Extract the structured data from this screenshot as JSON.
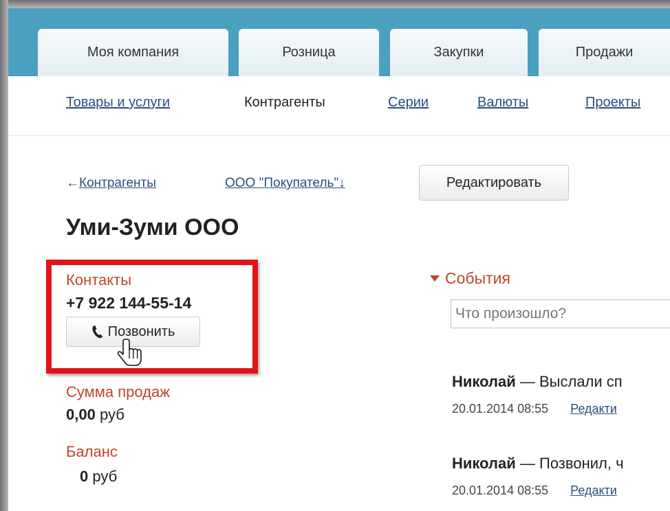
{
  "tabs": [
    {
      "label": "Моя компания"
    },
    {
      "label": "Розница"
    },
    {
      "label": "Закупки"
    },
    {
      "label": "Продажи"
    }
  ],
  "subnav": [
    {
      "label": "Товары и услуги"
    },
    {
      "label": "Контрагенты"
    },
    {
      "label": "Серии"
    },
    {
      "label": "Валюты"
    },
    {
      "label": "Проекты"
    }
  ],
  "breadcrumb": {
    "back_arrow": "←",
    "back_label": "Контрагенты",
    "org_label": "ООО \"Покупатель\"↓"
  },
  "edit_button": "Редактировать",
  "title": "Уми-Зуми ООО",
  "contacts": {
    "label": "Контакты",
    "phone": "+7 922 144-55-14",
    "call_button": "Позвонить"
  },
  "sales": {
    "label": "Сумма продаж",
    "amount": "0,00",
    "currency": "руб"
  },
  "balance": {
    "label": "Баланс",
    "amount": "0",
    "currency": "руб"
  },
  "events": {
    "header": "События",
    "search_placeholder": "Что произошло?",
    "items": [
      {
        "author": "Николай",
        "separator": " — ",
        "text": "Выслали сп",
        "date": "20.01.2014 08:55",
        "action": "Редакти"
      },
      {
        "author": "Николай",
        "separator": " — ",
        "text": "Позвонил, ч",
        "date": "20.01.2014 08:55",
        "action": "Редакти"
      }
    ]
  },
  "colors": {
    "topband": "#4aa0bf",
    "accent_red": "#c0452c",
    "highlight": "#e1141b",
    "link": "#2b4d7e"
  },
  "icons": {
    "phone": "phone-icon",
    "cursor": "hand-cursor-icon",
    "caret": "caret-down-icon"
  }
}
